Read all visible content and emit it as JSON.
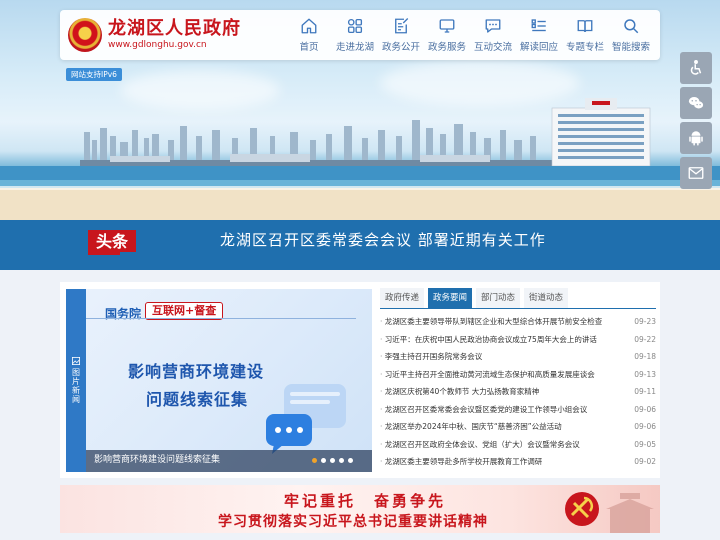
{
  "header": {
    "site_name": "龙湖区人民政府",
    "site_url": "www.gdlonghu.gov.cn",
    "nav": [
      {
        "label": "首页",
        "icon": "home-icon"
      },
      {
        "label": "走进龙湖",
        "icon": "grid-icon"
      },
      {
        "label": "政务公开",
        "icon": "document-edit-icon"
      },
      {
        "label": "政务服务",
        "icon": "monitor-icon"
      },
      {
        "label": "互动交流",
        "icon": "chat-icon"
      },
      {
        "label": "解读回应",
        "icon": "list-icon"
      },
      {
        "label": "专题专栏",
        "icon": "book-icon"
      },
      {
        "label": "智能搜索",
        "icon": "search-icon"
      }
    ]
  },
  "ipv6_badge": "网站支持IPv6",
  "tools": [
    {
      "icon": "accessibility-icon"
    },
    {
      "icon": "wechat-icon"
    },
    {
      "icon": "android-icon"
    },
    {
      "icon": "mail-icon"
    }
  ],
  "headline": {
    "badge": "头条",
    "text": "龙湖区召开区委常委会会议 部署近期有关工作"
  },
  "carousel": {
    "side_label": "图片新闻",
    "slide": {
      "org": "国务院",
      "tag": "互联网+督查",
      "title_line1": "影响营商环境建设",
      "title_line2": "问题线索征集"
    },
    "caption": "影响营商环境建设问题线索征集",
    "dot_count": 5,
    "active_dot": 0
  },
  "tabs": [
    {
      "label": "政府传递",
      "active": false
    },
    {
      "label": "政务要闻",
      "active": true
    },
    {
      "label": "部门动态",
      "active": false
    },
    {
      "label": "街道动态",
      "active": false
    }
  ],
  "news": [
    {
      "title": "龙湖区委主要领导带队到辖区企业和大型综合体开展节前安全检查",
      "date": "09-23"
    },
    {
      "title": "习近平：在庆祝中国人民政治协商会议成立75周年大会上的讲话",
      "date": "09-22"
    },
    {
      "title": "李强主持召开国务院常务会议",
      "date": "09-18"
    },
    {
      "title": "习近平主持召开全面推动黄河流域生态保护和高质量发展座谈会",
      "date": "09-13"
    },
    {
      "title": "龙湖区庆祝第40个教师节 大力弘扬教育家精神",
      "date": "09-11"
    },
    {
      "title": "龙湖区召开区委常委会会议暨区委党的建设工作领导小组会议",
      "date": "09-06"
    },
    {
      "title": "龙湖区举办2024年中秋、国庆节“慈善济困”公益活动",
      "date": "09-06"
    },
    {
      "title": "龙湖区召开区政府全体会议、党组（扩大）会议暨常务会议",
      "date": "09-05"
    },
    {
      "title": "龙湖区委主要领导赴多所学校开展教育工作调研",
      "date": "09-02"
    }
  ],
  "banner": {
    "line1": "牢记重托　奋勇争先",
    "line2": "学习贯彻落实习近平总书记重要讲话精神"
  },
  "colors": {
    "brand_red": "#c8161d",
    "primary_blue": "#1f6fae",
    "nav_text": "#4a6fa0"
  }
}
